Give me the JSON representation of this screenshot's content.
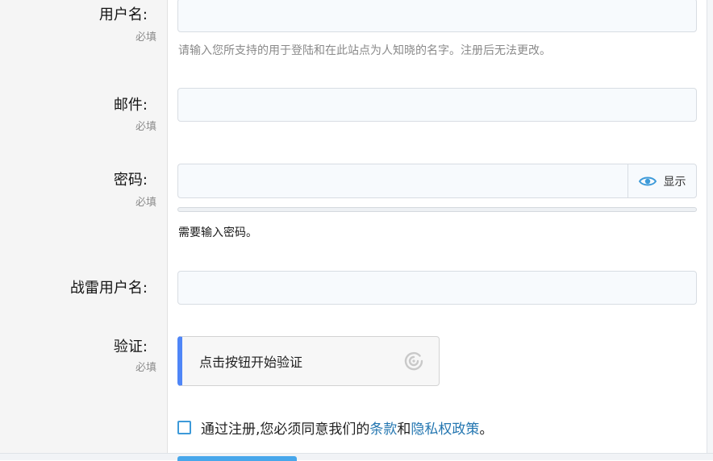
{
  "form": {
    "username": {
      "label": "用户名:",
      "required": "必填",
      "hint": "请输入您所支持的用于登陆和在此站点为人知晓的名字。注册后无法更改。",
      "value": ""
    },
    "email": {
      "label": "邮件:",
      "required": "必填",
      "value": ""
    },
    "password": {
      "label": "密码:",
      "required": "必填",
      "value": "",
      "show_label": "显示",
      "message": "需要输入密码。"
    },
    "warthunder": {
      "label": "战雷用户名:",
      "value": ""
    },
    "verify": {
      "label": "验证:",
      "required": "必填",
      "button_text": "点击按钮开始验证"
    },
    "terms": {
      "prefix": "通过注册,您必须同意我们的",
      "terms_link": "条款",
      "and": "和",
      "privacy_link": "隐私权政策",
      "suffix": "。"
    }
  },
  "colors": {
    "accent": "#4f86f7",
    "link": "#2577b1",
    "checkbox": "#3d9ad9",
    "submit": "#47a7eb"
  },
  "icons": {
    "show_password": "eye-icon",
    "captcha": "refresh-icon"
  }
}
